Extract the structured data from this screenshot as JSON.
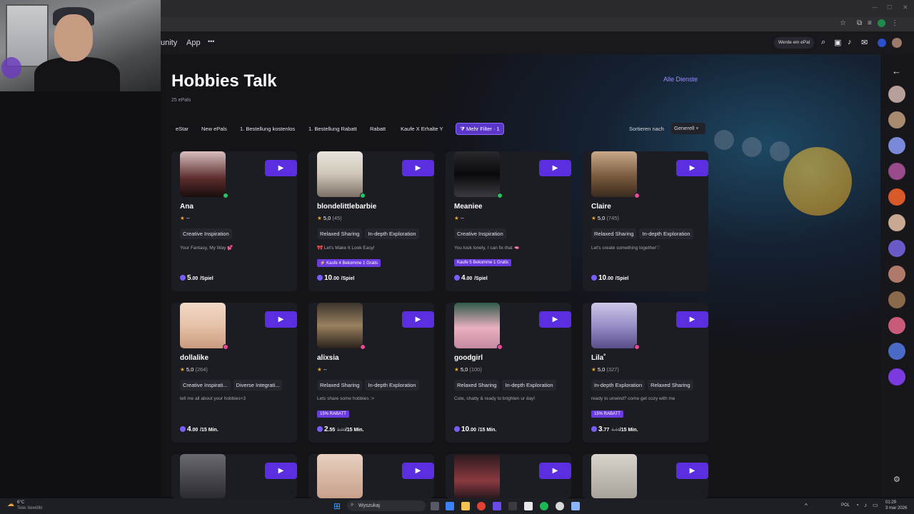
{
  "nav": {
    "link_community": "unity",
    "link_app": "App",
    "more": "•••",
    "werde": "Werde ein ePal"
  },
  "page": {
    "title": "Hobbies Talk",
    "subtitle": "25 ePals",
    "alle": "Alle Dienste"
  },
  "filters": [
    "eStar",
    "New ePals",
    "1. Bestellung kostenlos",
    "1. Bestellung Rabatt",
    "Rabatt",
    "Kaufe X Erhalte Y"
  ],
  "filter_more": "Mehr Filter · 1",
  "sort": {
    "label": "Sortieren nach",
    "value": "Generell"
  },
  "cards": [
    {
      "name": "Ana",
      "rating": "--",
      "count": "",
      "tags": [
        "Creative Inspiration"
      ],
      "bio": "Your Fantasy, My Way 💕",
      "promo": "",
      "price": "5",
      "dec": ".00",
      "unit": "/Spiel",
      "old": ""
    },
    {
      "name": "blondelittlebarbie",
      "rating": "5,0",
      "count": "(45)",
      "tags": [
        "Relaxed Sharing",
        "In-depth Exploration"
      ],
      "bio": "🎀 Let's Make It Look Easy!",
      "promo": "Kaufe 4 Bekomme 1 Gratis",
      "price": "10",
      "dec": ".00",
      "unit": "/Spiel",
      "old": ""
    },
    {
      "name": "Meaniee",
      "rating": "--",
      "count": "",
      "tags": [
        "Creative Inspiration"
      ],
      "bio": "You look lonely, I can fix that 🫦",
      "promo": "Kaufe 5 Bekomme 1 Gratis",
      "price": "4",
      "dec": ".00",
      "unit": "/Spiel",
      "old": ""
    },
    {
      "name": "Claire",
      "rating": "5,0",
      "count": "(745)",
      "tags": [
        "Relaxed Sharing",
        "In-depth Exploration"
      ],
      "bio": "Let's create something together♡",
      "promo": "",
      "price": "10",
      "dec": ".00",
      "unit": "/Spiel",
      "old": ""
    },
    {
      "name": "dollalike",
      "rating": "5,0",
      "count": "(264)",
      "tags": [
        "Creative Inspirati...",
        "Diverse Integrati..."
      ],
      "bio": "tell me all about your hobbies<3",
      "promo": "",
      "price": "4",
      "dec": ".00",
      "unit": "/15 Min.",
      "old": ""
    },
    {
      "name": "alixsia",
      "rating": "--",
      "count": "",
      "tags": [
        "Relaxed Sharing",
        "In-depth Exploration"
      ],
      "bio": "Lets share some hobbies :>",
      "promo": "15% RABATT",
      "price": "2",
      "dec": ".55",
      "unit": "/15 Min.",
      "old": "3,00"
    },
    {
      "name": "goodgirl",
      "rating": "5,0",
      "count": "(100)",
      "tags": [
        "Relaxed Sharing",
        "In-depth Exploration"
      ],
      "bio": "Cute, chatty & ready to brighten ur day!",
      "promo": "",
      "price": "10",
      "dec": ".00",
      "unit": "/15 Min.",
      "old": ""
    },
    {
      "name": "Lila˚",
      "rating": "5,0",
      "count": "(327)",
      "tags": [
        "In-depth Exploration",
        "Relaxed Sharing"
      ],
      "bio": "ready to unwind? come get cozy with me",
      "promo": "15% RABATT",
      "price": "3",
      "dec": ".77",
      "unit": "/15 Min.",
      "old": "4,44"
    }
  ],
  "taskbar": {
    "weather_temp": "6°C",
    "weather_desc": "Telw. bewölkt",
    "search": "Wyszukaj",
    "lang": "POL",
    "time": "01:29",
    "date": "3 mar 2026"
  },
  "colors": {
    "accent": "#5b2ee0",
    "online": "#22c55e",
    "busy": "#ec4899"
  }
}
